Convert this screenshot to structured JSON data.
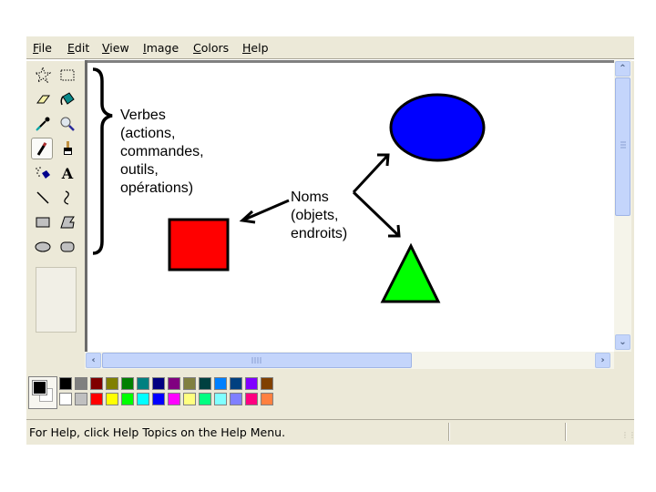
{
  "menu": [
    {
      "label": "File",
      "accel": "F",
      "rest": "ile"
    },
    {
      "label": "Edit",
      "accel": "E",
      "rest": "dit"
    },
    {
      "label": "View",
      "accel": "V",
      "rest": "iew"
    },
    {
      "label": "Image",
      "accel": "I",
      "rest": "mage"
    },
    {
      "label": "Colors",
      "accel": "C",
      "rest": "olors"
    },
    {
      "label": "Help",
      "accel": "H",
      "rest": "elp"
    }
  ],
  "tools": [
    {
      "name": "free-form-select",
      "icon": "star-dotted-icon"
    },
    {
      "name": "select",
      "icon": "rect-dotted-icon"
    },
    {
      "name": "eraser",
      "icon": "eraser-icon"
    },
    {
      "name": "fill-with-color",
      "icon": "paint-bucket-icon"
    },
    {
      "name": "pick-color",
      "icon": "eyedropper-icon"
    },
    {
      "name": "magnifier",
      "icon": "magnifier-icon"
    },
    {
      "name": "pencil",
      "icon": "pencil-icon",
      "selected": true
    },
    {
      "name": "brush",
      "icon": "brush-icon"
    },
    {
      "name": "airbrush",
      "icon": "airbrush-icon"
    },
    {
      "name": "text",
      "icon": "text-icon",
      "glyph": "A"
    },
    {
      "name": "line",
      "icon": "line-icon"
    },
    {
      "name": "curve",
      "icon": "curve-icon"
    },
    {
      "name": "rectangle",
      "icon": "rectangle-icon"
    },
    {
      "name": "polygon",
      "icon": "polygon-icon"
    },
    {
      "name": "ellipse",
      "icon": "ellipse-icon"
    },
    {
      "name": "rounded-rectangle",
      "icon": "rounded-rect-icon"
    }
  ],
  "palette": {
    "foreground": "#000000",
    "background": "#ffffff",
    "top_row": [
      "#000000",
      "#808080",
      "#800000",
      "#808000",
      "#008000",
      "#008080",
      "#000080",
      "#800080",
      "#808040",
      "#004040",
      "#0080ff",
      "#004080",
      "#8000ff",
      "#804000"
    ],
    "bottom_row": [
      "#ffffff",
      "#c0c0c0",
      "#ff0000",
      "#ffff00",
      "#00ff00",
      "#00ffff",
      "#0000ff",
      "#ff00ff",
      "#ffff80",
      "#00ff80",
      "#80ffff",
      "#8080ff",
      "#ff0080",
      "#ff8040"
    ]
  },
  "canvas": {
    "verbs_label": [
      "Verbes",
      "(actions,",
      "commandes,",
      "outils,",
      "opérations)"
    ],
    "nouns_label": [
      "Noms",
      "(objets,",
      "endroits)"
    ],
    "shapes": {
      "rectangle_fill": "#ff0000",
      "ellipse_fill": "#0000ff",
      "triangle_fill": "#00ff00"
    }
  },
  "statusbar": {
    "text": "For Help, click Help Topics on the Help Menu."
  }
}
